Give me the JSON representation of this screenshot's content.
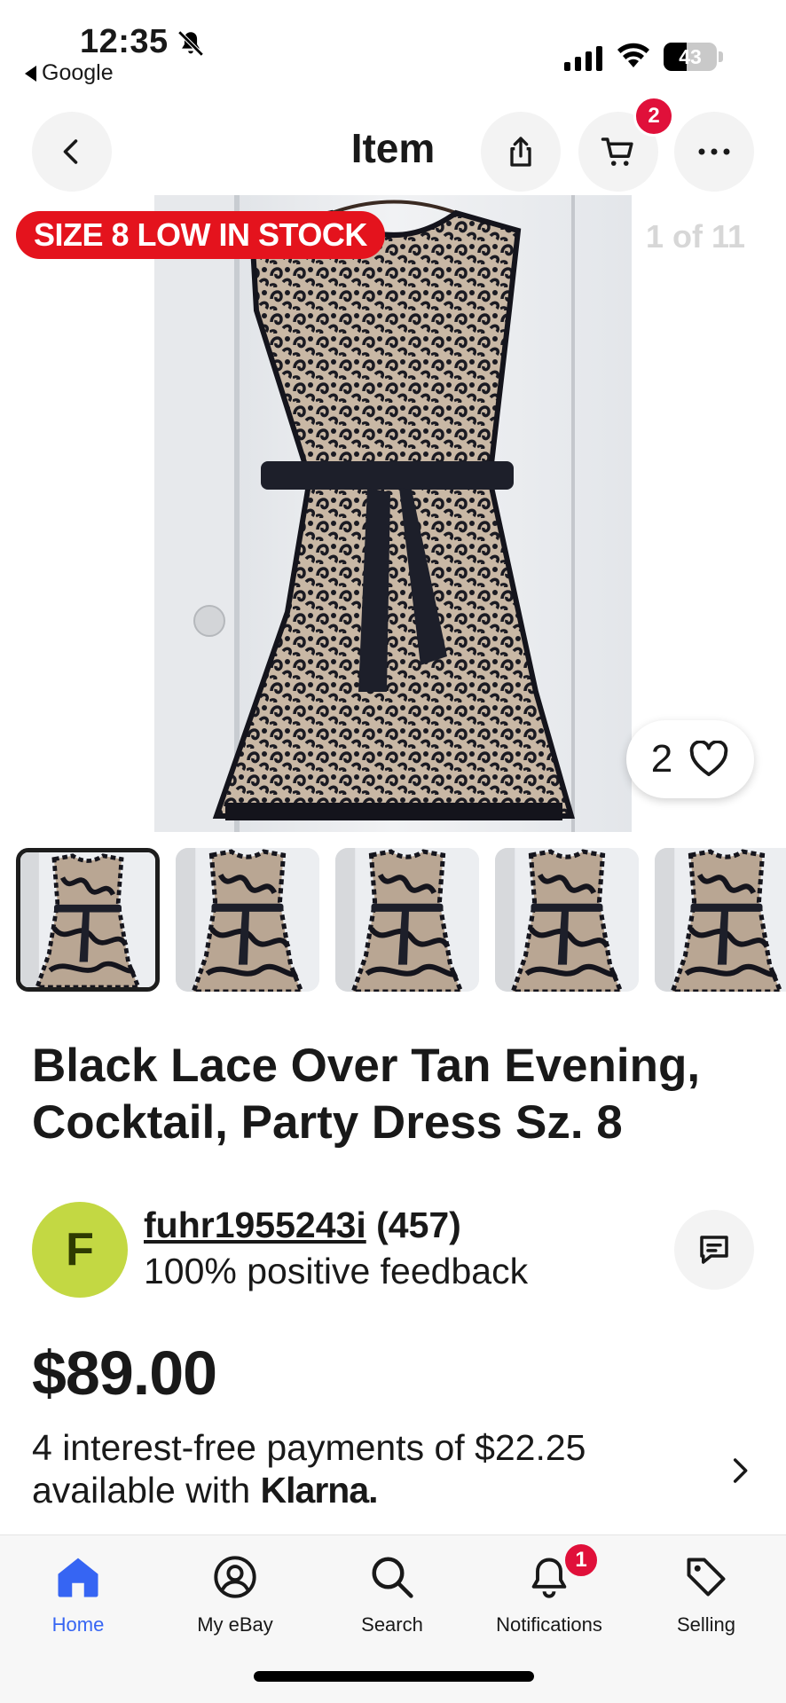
{
  "status_bar": {
    "time": "12:35",
    "back_app": "Google",
    "battery_level": "43"
  },
  "header": {
    "title": "Item",
    "cart_count": "2"
  },
  "hero": {
    "stock_badge": "SIZE 8 LOW IN STOCK",
    "counter": "1 of 11",
    "watchers": "2"
  },
  "thumbnails": [
    {
      "selected": true
    },
    {
      "selected": false
    },
    {
      "selected": false
    },
    {
      "selected": false
    },
    {
      "selected": false
    }
  ],
  "listing": {
    "title": "Black Lace Over Tan Evening, Cocktail, Party Dress Sz. 8",
    "seller": {
      "initial": "F",
      "name": "fuhr1955243i",
      "rating_count": "(457)",
      "feedback": "100% positive feedback"
    },
    "price": "$89.00",
    "installments": {
      "text": "4 interest-free payments of $22.25 available with",
      "provider": "Klarna."
    }
  },
  "bottom_nav": {
    "items": [
      {
        "label": "Home",
        "icon": "home-icon",
        "active": true
      },
      {
        "label": "My eBay",
        "icon": "profile-icon",
        "active": false
      },
      {
        "label": "Search",
        "icon": "search-icon",
        "active": false
      },
      {
        "label": "Notifications",
        "icon": "bell-icon",
        "active": false
      },
      {
        "label": "Selling",
        "icon": "tag-icon",
        "active": false
      }
    ],
    "notifications_badge": "1"
  },
  "colors": {
    "accent": "#3665f3",
    "badge_red": "#e0103a",
    "stock_red": "#e4131d",
    "avatar_bg": "#c3d843"
  }
}
